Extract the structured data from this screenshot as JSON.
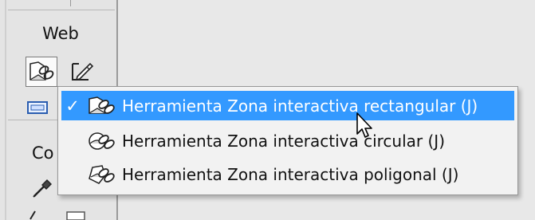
{
  "tools_panel": {
    "section_web_label": "Web",
    "section_colors_label_partial": "Co"
  },
  "hotspot_menu": {
    "items": [
      {
        "label": "Herramienta Zona interactiva rectangular (J)",
        "checked": true,
        "highlighted": true,
        "icon": "rectangle-hotspot-icon"
      },
      {
        "label": "Herramienta Zona interactiva circular (J)",
        "checked": false,
        "highlighted": false,
        "icon": "circle-hotspot-icon"
      },
      {
        "label": "Herramienta Zona interactiva poligonal (J)",
        "checked": false,
        "highlighted": false,
        "icon": "polygon-hotspot-icon"
      }
    ],
    "check_mark": "✓",
    "highlight_color": "#3399ff"
  }
}
